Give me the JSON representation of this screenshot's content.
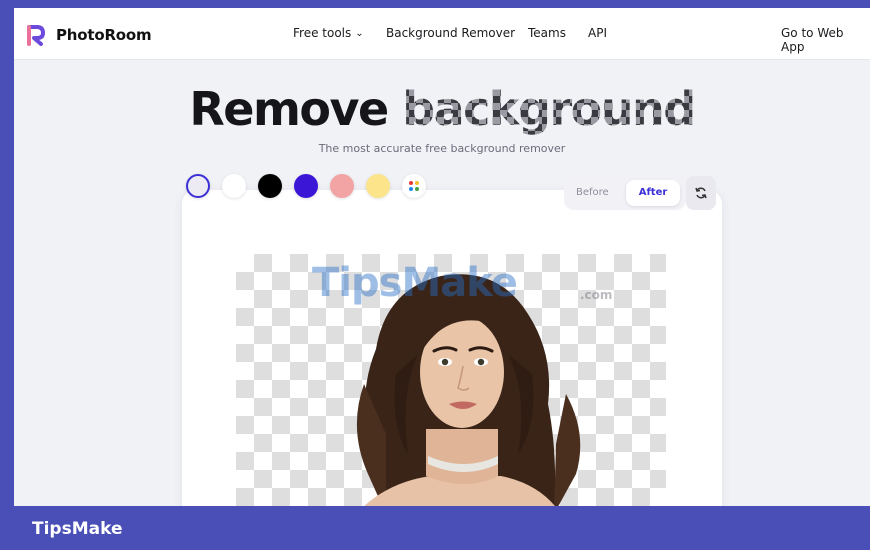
{
  "app": {
    "name": "PhotoRoom",
    "accent": "#3b2fd6"
  },
  "nav": {
    "links": [
      "Free tools",
      "Background Remover",
      "Teams",
      "API"
    ],
    "cta": "Go to Web App",
    "dropdown_icon": "chevron-down-icon"
  },
  "hero": {
    "title_part1": "Remove",
    "title_part2": "background",
    "subtitle": "The most accurate free background remover"
  },
  "editor": {
    "background_swatches": [
      {
        "name": "transparent",
        "color": "#eceaf2",
        "selected": true
      },
      {
        "name": "white",
        "color": "#ffffff",
        "selected": false
      },
      {
        "name": "black",
        "color": "#000000",
        "selected": false
      },
      {
        "name": "indigo",
        "color": "#3b16d6",
        "selected": false
      },
      {
        "name": "pink",
        "color": "#f2a3a3",
        "selected": false
      },
      {
        "name": "yellow",
        "color": "#fbe48a",
        "selected": false
      },
      {
        "name": "custom",
        "color": "#ffffff",
        "selected": false
      }
    ],
    "toggle": {
      "before": "Before",
      "after": "After",
      "active": "After"
    },
    "refresh_icon": "refresh-icon"
  },
  "watermark": {
    "text": "TipsMake",
    "domain": ".com"
  },
  "footer": {
    "text": "TipsMake",
    "bar_color": "#4a4fb8"
  }
}
